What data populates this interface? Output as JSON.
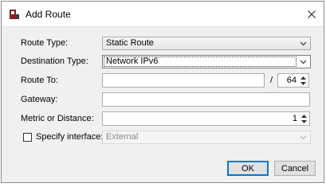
{
  "window": {
    "title": "Add Route"
  },
  "form": {
    "route_type": {
      "label": "Route Type:",
      "value": "Static Route"
    },
    "destination_type": {
      "label": "Destination Type:",
      "value": "Network IPv6"
    },
    "route_to": {
      "label": "Route To:",
      "value": "",
      "separator": "/",
      "prefix": "64"
    },
    "gateway": {
      "label": "Gateway:",
      "value": ""
    },
    "metric": {
      "label": "Metric or Distance:",
      "value": "1"
    },
    "specify_interface": {
      "label": "Specify interface:",
      "checked": false,
      "value": "External"
    }
  },
  "buttons": {
    "ok": "OK",
    "cancel": "Cancel"
  },
  "icons": {
    "app": "firewall-app-icon",
    "close": "close-icon",
    "dropdown": "chevron-down-icon",
    "spin_up": "spin-up-icon",
    "spin_down": "spin-down-icon"
  },
  "colors": {
    "focus_accent": "#0078d7",
    "app_icon": "#8b1c1c"
  }
}
